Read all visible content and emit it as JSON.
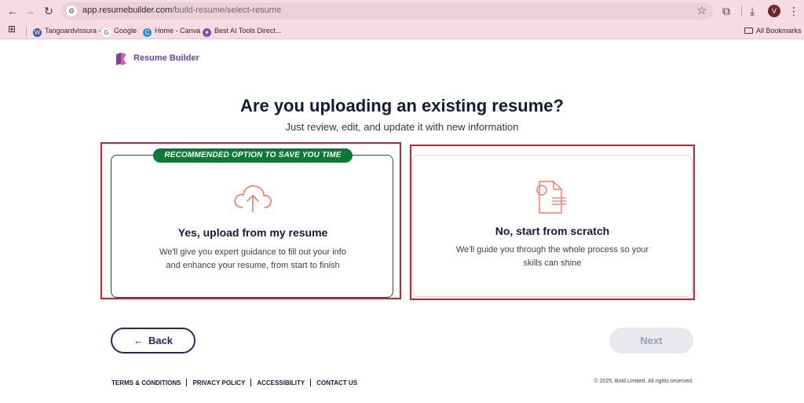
{
  "browser": {
    "url_host": "app.resumebuilder.com",
    "url_path": "/build-resume/select-resume",
    "avatar_letter": "V",
    "bookmarks": [
      {
        "label": "Tangoardvissura -",
        "icon_color": "#3b5998"
      },
      {
        "label": "Google",
        "icon_color": "#ffffff"
      },
      {
        "label": "Home - Canva",
        "icon_color": "#1c8fd4"
      },
      {
        "label": "Best AI Tools Direct...",
        "icon_color": "#7b4fb3"
      }
    ],
    "all_bookmarks": "All Bookmarks"
  },
  "page": {
    "logo_text": "Resume Builder",
    "title": "Are you uploading an existing resume?",
    "subtitle": "Just review, edit, and update it with new information",
    "options": [
      {
        "badge": "RECOMMENDED OPTION TO SAVE YOU TIME",
        "title": "Yes, upload from my resume",
        "description_line1": "We'll give you expert guidance to fill out your info",
        "description_line2": "and enhance your resume, from start to finish",
        "icon": "cloud-upload-icon"
      },
      {
        "title": "No, start from scratch",
        "description_line1": "We'll guide you through the whole process so your",
        "description_line2": "skills can shine",
        "icon": "document-icon"
      }
    ],
    "back_label": "Back",
    "next_label": "Next"
  },
  "footer": {
    "links": [
      "TERMS & CONDITIONS",
      "PRIVACY POLICY",
      "ACCESSIBILITY",
      "CONTACT US"
    ],
    "copyright": "© 2025, Bold Limited. All rights reserved."
  },
  "colors": {
    "accent_navy": "#1c2a6b",
    "badge_green": "#0b7a36",
    "highlight_red": "#d11f2d",
    "icon_coral": "#f07b5c"
  }
}
